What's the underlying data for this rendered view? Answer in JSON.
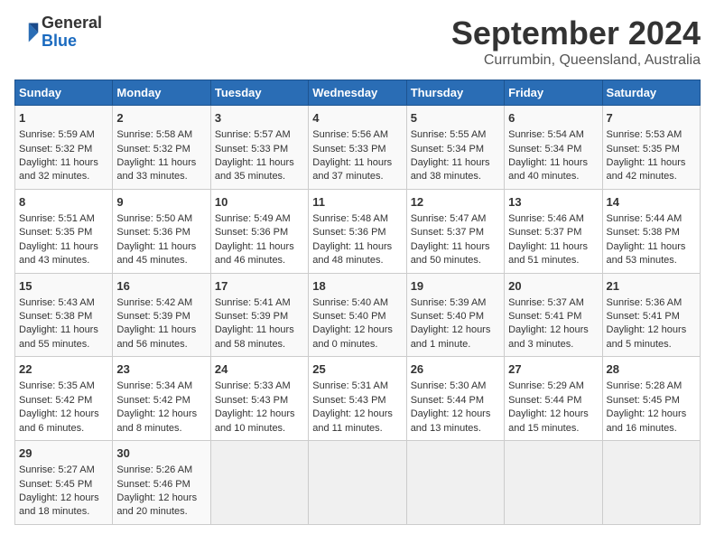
{
  "logo": {
    "line1": "General",
    "line2": "Blue"
  },
  "title": "September 2024",
  "subtitle": "Currumbin, Queensland, Australia",
  "weekdays": [
    "Sunday",
    "Monday",
    "Tuesday",
    "Wednesday",
    "Thursday",
    "Friday",
    "Saturday"
  ],
  "weeks": [
    [
      {
        "day": "1",
        "sunrise": "5:59 AM",
        "sunset": "5:32 PM",
        "daylight": "11 hours and 32 minutes."
      },
      {
        "day": "2",
        "sunrise": "5:58 AM",
        "sunset": "5:32 PM",
        "daylight": "11 hours and 33 minutes."
      },
      {
        "day": "3",
        "sunrise": "5:57 AM",
        "sunset": "5:33 PM",
        "daylight": "11 hours and 35 minutes."
      },
      {
        "day": "4",
        "sunrise": "5:56 AM",
        "sunset": "5:33 PM",
        "daylight": "11 hours and 37 minutes."
      },
      {
        "day": "5",
        "sunrise": "5:55 AM",
        "sunset": "5:34 PM",
        "daylight": "11 hours and 38 minutes."
      },
      {
        "day": "6",
        "sunrise": "5:54 AM",
        "sunset": "5:34 PM",
        "daylight": "11 hours and 40 minutes."
      },
      {
        "day": "7",
        "sunrise": "5:53 AM",
        "sunset": "5:35 PM",
        "daylight": "11 hours and 42 minutes."
      }
    ],
    [
      {
        "day": "8",
        "sunrise": "5:51 AM",
        "sunset": "5:35 PM",
        "daylight": "11 hours and 43 minutes."
      },
      {
        "day": "9",
        "sunrise": "5:50 AM",
        "sunset": "5:36 PM",
        "daylight": "11 hours and 45 minutes."
      },
      {
        "day": "10",
        "sunrise": "5:49 AM",
        "sunset": "5:36 PM",
        "daylight": "11 hours and 46 minutes."
      },
      {
        "day": "11",
        "sunrise": "5:48 AM",
        "sunset": "5:36 PM",
        "daylight": "11 hours and 48 minutes."
      },
      {
        "day": "12",
        "sunrise": "5:47 AM",
        "sunset": "5:37 PM",
        "daylight": "11 hours and 50 minutes."
      },
      {
        "day": "13",
        "sunrise": "5:46 AM",
        "sunset": "5:37 PM",
        "daylight": "11 hours and 51 minutes."
      },
      {
        "day": "14",
        "sunrise": "5:44 AM",
        "sunset": "5:38 PM",
        "daylight": "11 hours and 53 minutes."
      }
    ],
    [
      {
        "day": "15",
        "sunrise": "5:43 AM",
        "sunset": "5:38 PM",
        "daylight": "11 hours and 55 minutes."
      },
      {
        "day": "16",
        "sunrise": "5:42 AM",
        "sunset": "5:39 PM",
        "daylight": "11 hours and 56 minutes."
      },
      {
        "day": "17",
        "sunrise": "5:41 AM",
        "sunset": "5:39 PM",
        "daylight": "11 hours and 58 minutes."
      },
      {
        "day": "18",
        "sunrise": "5:40 AM",
        "sunset": "5:40 PM",
        "daylight": "12 hours and 0 minutes."
      },
      {
        "day": "19",
        "sunrise": "5:39 AM",
        "sunset": "5:40 PM",
        "daylight": "12 hours and 1 minute."
      },
      {
        "day": "20",
        "sunrise": "5:37 AM",
        "sunset": "5:41 PM",
        "daylight": "12 hours and 3 minutes."
      },
      {
        "day": "21",
        "sunrise": "5:36 AM",
        "sunset": "5:41 PM",
        "daylight": "12 hours and 5 minutes."
      }
    ],
    [
      {
        "day": "22",
        "sunrise": "5:35 AM",
        "sunset": "5:42 PM",
        "daylight": "12 hours and 6 minutes."
      },
      {
        "day": "23",
        "sunrise": "5:34 AM",
        "sunset": "5:42 PM",
        "daylight": "12 hours and 8 minutes."
      },
      {
        "day": "24",
        "sunrise": "5:33 AM",
        "sunset": "5:43 PM",
        "daylight": "12 hours and 10 minutes."
      },
      {
        "day": "25",
        "sunrise": "5:31 AM",
        "sunset": "5:43 PM",
        "daylight": "12 hours and 11 minutes."
      },
      {
        "day": "26",
        "sunrise": "5:30 AM",
        "sunset": "5:44 PM",
        "daylight": "12 hours and 13 minutes."
      },
      {
        "day": "27",
        "sunrise": "5:29 AM",
        "sunset": "5:44 PM",
        "daylight": "12 hours and 15 minutes."
      },
      {
        "day": "28",
        "sunrise": "5:28 AM",
        "sunset": "5:45 PM",
        "daylight": "12 hours and 16 minutes."
      }
    ],
    [
      {
        "day": "29",
        "sunrise": "5:27 AM",
        "sunset": "5:45 PM",
        "daylight": "12 hours and 18 minutes."
      },
      {
        "day": "30",
        "sunrise": "5:26 AM",
        "sunset": "5:46 PM",
        "daylight": "12 hours and 20 minutes."
      },
      null,
      null,
      null,
      null,
      null
    ]
  ]
}
